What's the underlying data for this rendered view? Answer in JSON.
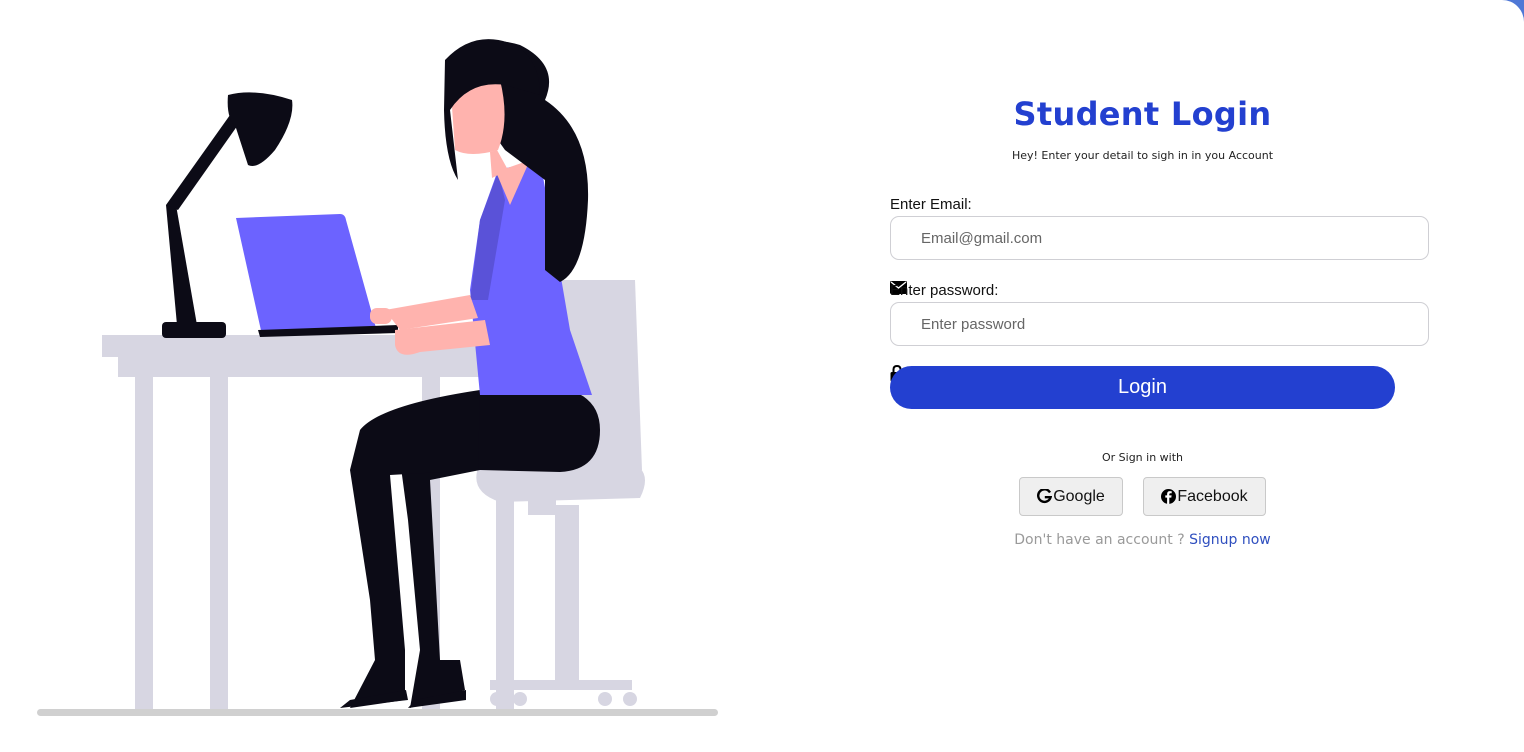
{
  "login": {
    "title": "Student Login",
    "subtitle": "Hey! Enter your detail to sigh in in you Account",
    "email_label": "Enter Email:",
    "email_placeholder": "Email@gmail.com",
    "password_label": "Enter password:",
    "password_placeholder": "Enter password",
    "login_button": "Login",
    "alt_signin": "Or Sign in with",
    "google_button": "Google",
    "facebook_button": "Facebook",
    "signup_prompt": "Don't have an account ? ",
    "signup_link": "Signup now"
  },
  "icons": {
    "email": "envelope-icon",
    "password": "lock-icon",
    "google": "google-icon",
    "facebook": "facebook-icon"
  },
  "colors": {
    "brand": "#2340d0",
    "accent_purple": "#6c63ff",
    "dark": "#0c0b16",
    "skin": "#ffb3ae",
    "furniture": "#d7d6e2"
  }
}
